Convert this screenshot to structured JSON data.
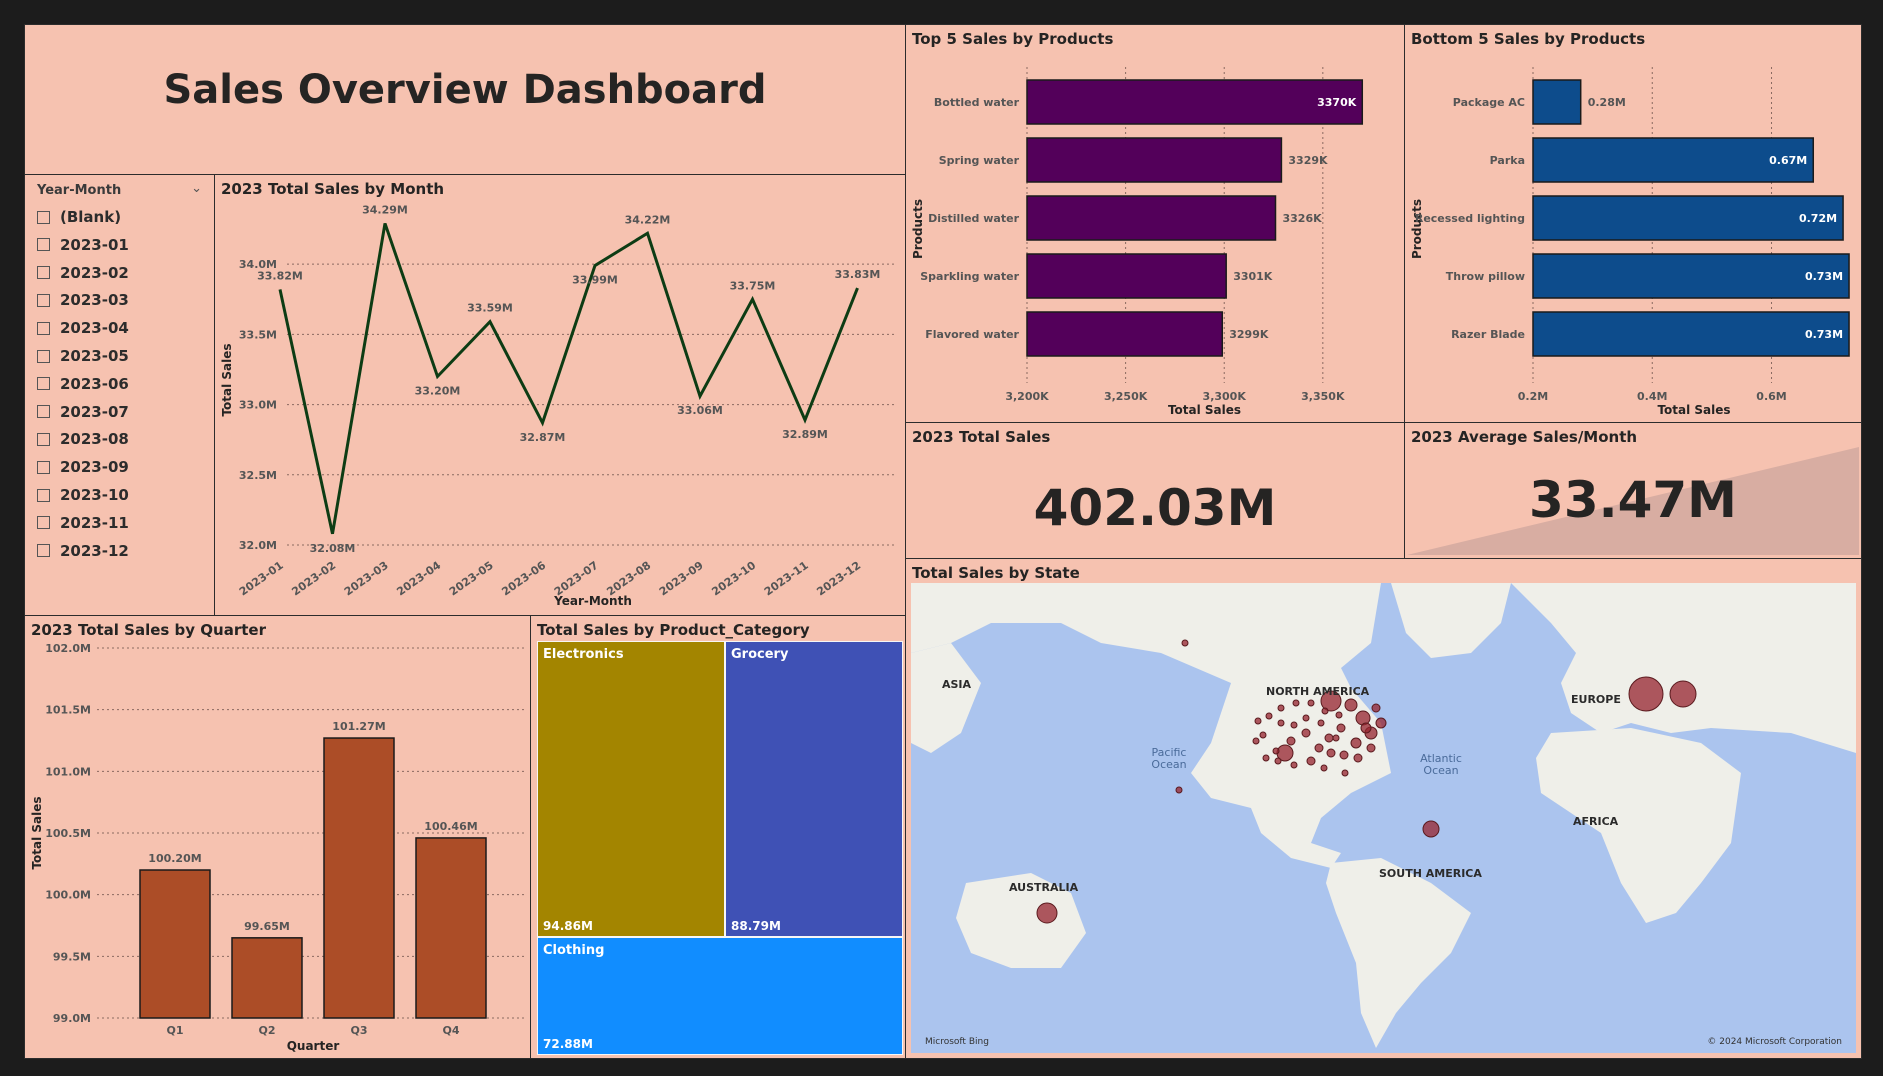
{
  "title": "Sales Overview Dashboard",
  "slicer": {
    "header": "Year-Month",
    "items": [
      "(Blank)",
      "2023-01",
      "2023-02",
      "2023-03",
      "2023-04",
      "2023-05",
      "2023-06",
      "2023-07",
      "2023-08",
      "2023-09",
      "2023-10",
      "2023-11",
      "2023-12"
    ]
  },
  "panels": {
    "monthly": "2023 Total Sales by Month",
    "quarterly": "2023 Total Sales by Quarter",
    "category": "Total Sales by Product_Category",
    "top5": "Top 5 Sales by Products",
    "bottom5": "Bottom 5 Sales by Products",
    "total_sales": "2023 Total Sales",
    "avg_sales": "2023 Average Sales/Month",
    "state": "Total Sales by State"
  },
  "kpis": {
    "total_sales_value": "402.03M",
    "avg_sales_value": "33.47M"
  },
  "treemap": [
    {
      "label": "Electronics",
      "value": "94.86M",
      "color": "#a38500"
    },
    {
      "label": "Grocery",
      "value": "88.79M",
      "color": "#3f51b5"
    },
    {
      "label": "Clothing",
      "value": "72.88M",
      "color": "#118dff"
    }
  ],
  "map": {
    "continents": [
      "ASIA",
      "NORTH AMERICA",
      "EUROPE",
      "AFRICA",
      "SOUTH AMERICA",
      "AUSTRALIA"
    ],
    "oceans": [
      "Pacific Ocean",
      "Atlantic Ocean"
    ],
    "attribution_left": "Microsoft Bing",
    "attribution_right": "© 2024 Microsoft Corporation"
  },
  "chart_data": [
    {
      "id": "monthly",
      "type": "line",
      "xlabel": "Year-Month",
      "ylabel": "Total Sales",
      "categories": [
        "2023-01",
        "2023-02",
        "2023-03",
        "2023-04",
        "2023-05",
        "2023-06",
        "2023-07",
        "2023-08",
        "2023-09",
        "2023-10",
        "2023-11",
        "2023-12"
      ],
      "values": [
        33.82,
        32.08,
        34.29,
        33.2,
        33.59,
        32.87,
        33.99,
        34.22,
        33.06,
        33.75,
        32.89,
        33.83
      ],
      "labels": [
        "33.82M",
        "32.08M",
        "34.29M",
        "33.20M",
        "33.59M",
        "32.87M",
        "33.99M",
        "34.22M",
        "33.06M",
        "33.75M",
        "32.89M",
        "33.83M"
      ],
      "yticks": [
        "32.0M",
        "32.5M",
        "33.0M",
        "33.5M",
        "34.0M"
      ],
      "ylim": [
        32.0,
        34.35
      ],
      "color": "#0d3c14"
    },
    {
      "id": "quarterly",
      "type": "bar",
      "xlabel": "Quarter",
      "ylabel": "Total Sales",
      "categories": [
        "Q1",
        "Q2",
        "Q3",
        "Q4"
      ],
      "values": [
        100.2,
        99.65,
        101.27,
        100.46
      ],
      "labels": [
        "100.20M",
        "99.65M",
        "101.27M",
        "100.46M"
      ],
      "yticks": [
        "99.0M",
        "99.5M",
        "100.0M",
        "100.5M",
        "101.0M",
        "101.5M",
        "102.0M"
      ],
      "ylim": [
        99.0,
        102.0
      ],
      "color": "#ac4d27"
    },
    {
      "id": "top5",
      "type": "bar",
      "orientation": "horizontal",
      "xlabel": "Total Sales",
      "ylabel": "Products",
      "categories": [
        "Bottled water",
        "Spring water",
        "Distilled water",
        "Sparkling water",
        "Flavored water"
      ],
      "values": [
        3370,
        3329,
        3326,
        3301,
        3299
      ],
      "labels": [
        "3370K",
        "3329K",
        "3326K",
        "3301K",
        "3299K"
      ],
      "xticks": [
        "3,200K",
        "3,250K",
        "3,300K",
        "3,350K"
      ],
      "xlim": [
        3200,
        3380
      ],
      "color": "#53005a"
    },
    {
      "id": "bottom5",
      "type": "bar",
      "orientation": "horizontal",
      "xlabel": "Total Sales",
      "ylabel": "Products",
      "categories": [
        "Package AC",
        "Parka",
        "Recessed lighting",
        "Throw pillow",
        "Razer Blade"
      ],
      "values": [
        0.28,
        0.67,
        0.72,
        0.73,
        0.73
      ],
      "labels": [
        "0.28M",
        "0.67M",
        "0.72M",
        "0.73M",
        "0.73M"
      ],
      "xticks": [
        "0.2M",
        "0.4M",
        "0.6M"
      ],
      "xlim": [
        0.2,
        0.74
      ],
      "color": "#0d4c8c"
    }
  ]
}
